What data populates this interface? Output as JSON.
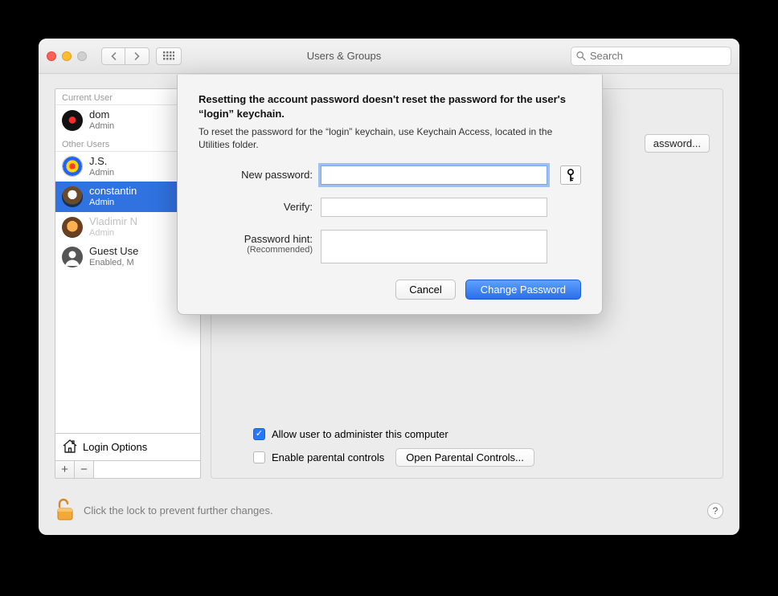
{
  "window": {
    "title": "Users & Groups",
    "search_placeholder": "Search"
  },
  "sidebar": {
    "current_header": "Current User",
    "other_header": "Other Users",
    "users": [
      {
        "name": "dom",
        "role": "Admin"
      },
      {
        "name": "J.S.",
        "role": "Admin"
      },
      {
        "name": "constantin",
        "role": "Admin"
      },
      {
        "name": "Vladimir N",
        "role": "Admin"
      },
      {
        "name": "Guest Use",
        "role": "Enabled, M"
      }
    ],
    "login_options": "Login Options",
    "add": "+",
    "remove": "−"
  },
  "main": {
    "reset_password_button": "assword...",
    "allow_admin_label": "Allow user to administer this computer",
    "parental_label": "Enable parental controls",
    "open_parental_button": "Open Parental Controls..."
  },
  "lock": {
    "text": "Click the lock to prevent further changes.",
    "help": "?"
  },
  "sheet": {
    "headline": "Resetting the account password doesn't reset the password for the user's “login” keychain.",
    "subtext": "To reset the password for the “login” keychain, use Keychain Access, located in the Utilities folder.",
    "labels": {
      "new_password": "New password:",
      "verify": "Verify:",
      "hint": "Password hint:",
      "hint_sub": "(Recommended)"
    },
    "values": {
      "new_password": "",
      "verify": "",
      "hint": ""
    },
    "buttons": {
      "cancel": "Cancel",
      "change": "Change Password"
    }
  }
}
